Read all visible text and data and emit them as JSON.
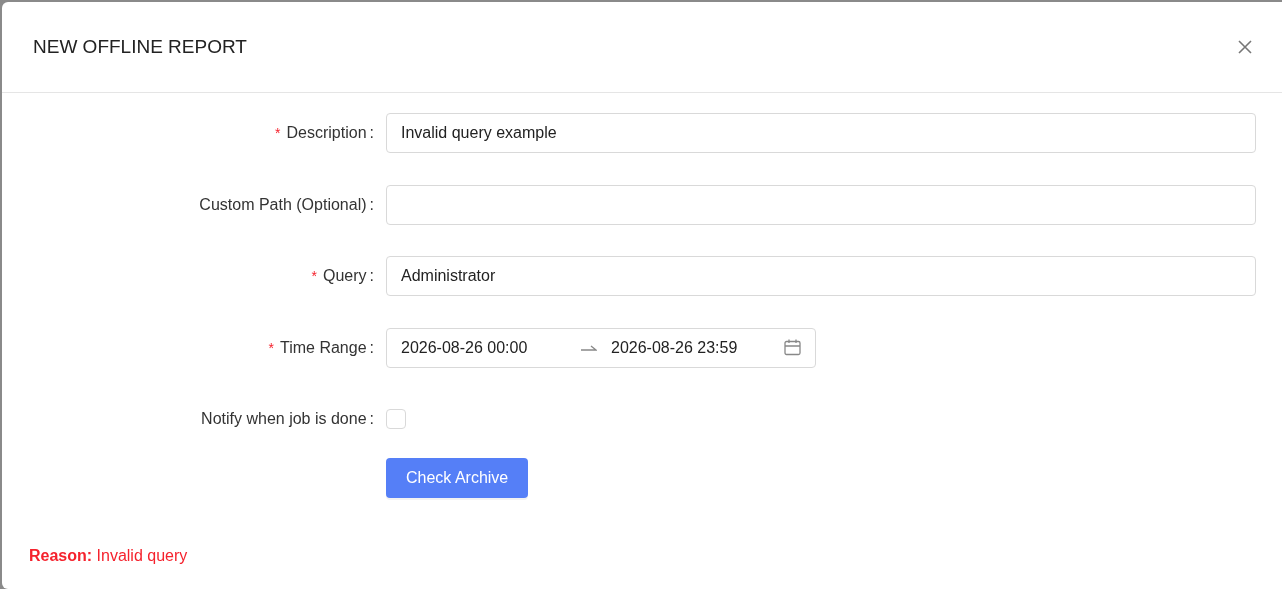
{
  "dialog": {
    "title": "NEW OFFLINE REPORT"
  },
  "fields": [
    {
      "kind": "text",
      "label": "Description",
      "separator": ":",
      "required_mark": "*",
      "value": "Invalid query example"
    },
    {
      "kind": "text",
      "label": "Custom Path (Optional)",
      "separator": ":"
    },
    {
      "kind": "text",
      "label": "Query",
      "separator": ":",
      "required_mark": "*",
      "value": "Administrator"
    },
    {
      "kind": "daterange",
      "label": "Time Range",
      "separator": ":",
      "required_mark": "*",
      "start": "2026-08-26 00:00",
      "end": "2026-08-26 23:59"
    },
    {
      "kind": "checkbox",
      "label": "Notify when job is done",
      "separator": ":",
      "checked": false
    }
  ],
  "button": "Check Archive",
  "error": "**Reason:** Invalid query"
}
